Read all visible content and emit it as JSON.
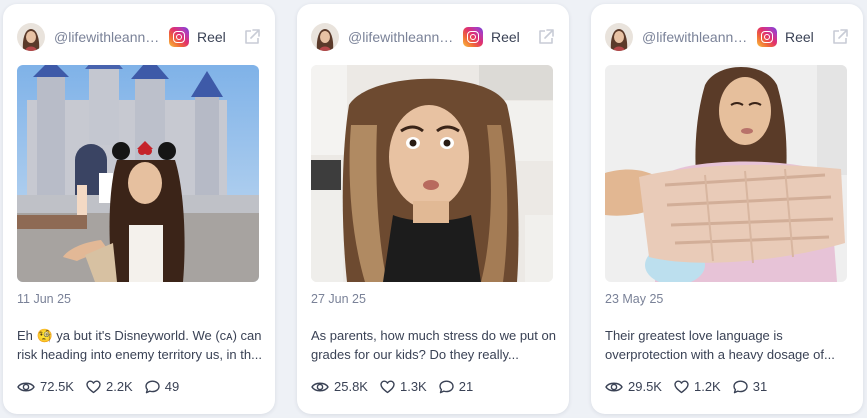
{
  "colors": {
    "page_background": "#eef1f6",
    "card_background": "#ffffff",
    "muted_text": "#7a8298",
    "body_text": "#3a4255",
    "icon_gray": "#3a4255"
  },
  "cards": [
    {
      "handle": "@lifewithleannel...",
      "platform_icon": "instagram-icon",
      "type_label": "Reel",
      "open_icon": "external-link-icon",
      "thumbnail": "woman in minnie-ears headband posing in front of castle at theme park",
      "date": "11 Jun 25",
      "caption": "Eh 🧐 ya but it's Disneyworld. We (ᴄᴀ) can risk heading into enemy territory us, in th...",
      "views": "72.5K",
      "likes": "2.2K",
      "comments": "49"
    },
    {
      "handle": "@lifewithleannel...",
      "platform_icon": "instagram-icon",
      "type_label": "Reel",
      "open_icon": "external-link-icon",
      "thumbnail": "woman with surprised expression in a kitchen",
      "date": "27 Jun 25",
      "caption": "As parents, how much stress do we put on grades for our kids? Do they really...",
      "views": "25.8K",
      "likes": "1.3K",
      "comments": "21"
    },
    {
      "handle": "@lifewithleannel...",
      "platform_icon": "instagram-icon",
      "type_label": "Reel",
      "open_icon": "external-link-icon",
      "thumbnail": "woman holding a rolled up beige knitted fabric",
      "date": "23 May 25",
      "caption": "Their greatest love language is overprotection with a heavy dosage of...",
      "views": "29.5K",
      "likes": "1.2K",
      "comments": "31"
    }
  ]
}
